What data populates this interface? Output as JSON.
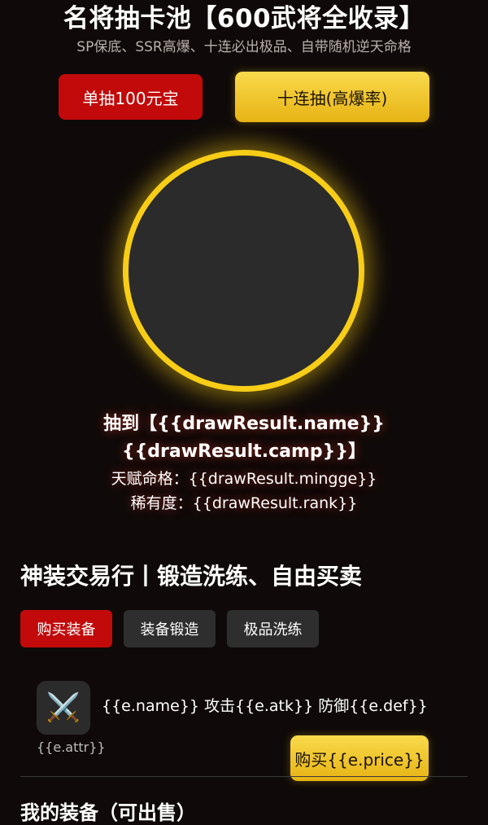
{
  "header": {
    "title": "名将抽卡池【600武将全收录】",
    "subtitle": "SP保底、SSR高爆、十连必出极品、自带随机逆天命格"
  },
  "draw": {
    "single_label": "单抽100元宝",
    "ten_label": "十连抽(高爆率)"
  },
  "result": {
    "line1": "抽到【{{drawResult.name}}",
    "line2": "{{drawResult.camp}}】",
    "line3": "天赋命格：{{drawResult.mingge}}",
    "line4": "稀有度：{{drawResult.rank}}"
  },
  "market": {
    "title": "神装交易行丨锻造洗练、自由买卖",
    "tabs": [
      {
        "label": "购买装备",
        "active": true
      },
      {
        "label": "装备锻造",
        "active": false
      },
      {
        "label": "极品洗练",
        "active": false
      }
    ],
    "item": {
      "icon": "⚔️",
      "info": "{{e.name}} 攻击{{e.atk}} 防御{{e.def}}",
      "attr": "{{e.attr}}",
      "buy_label": "购买{{e.price}}"
    }
  },
  "next_section": {
    "title": "我的装备（可出售）"
  },
  "colors": {
    "background": "#0f0a09",
    "red": "#c20a0a",
    "gold": "#f7cd17",
    "tab_inactive": "#2e2e2e"
  },
  "icons": {
    "item_icon": "crossed-swords-icon"
  }
}
